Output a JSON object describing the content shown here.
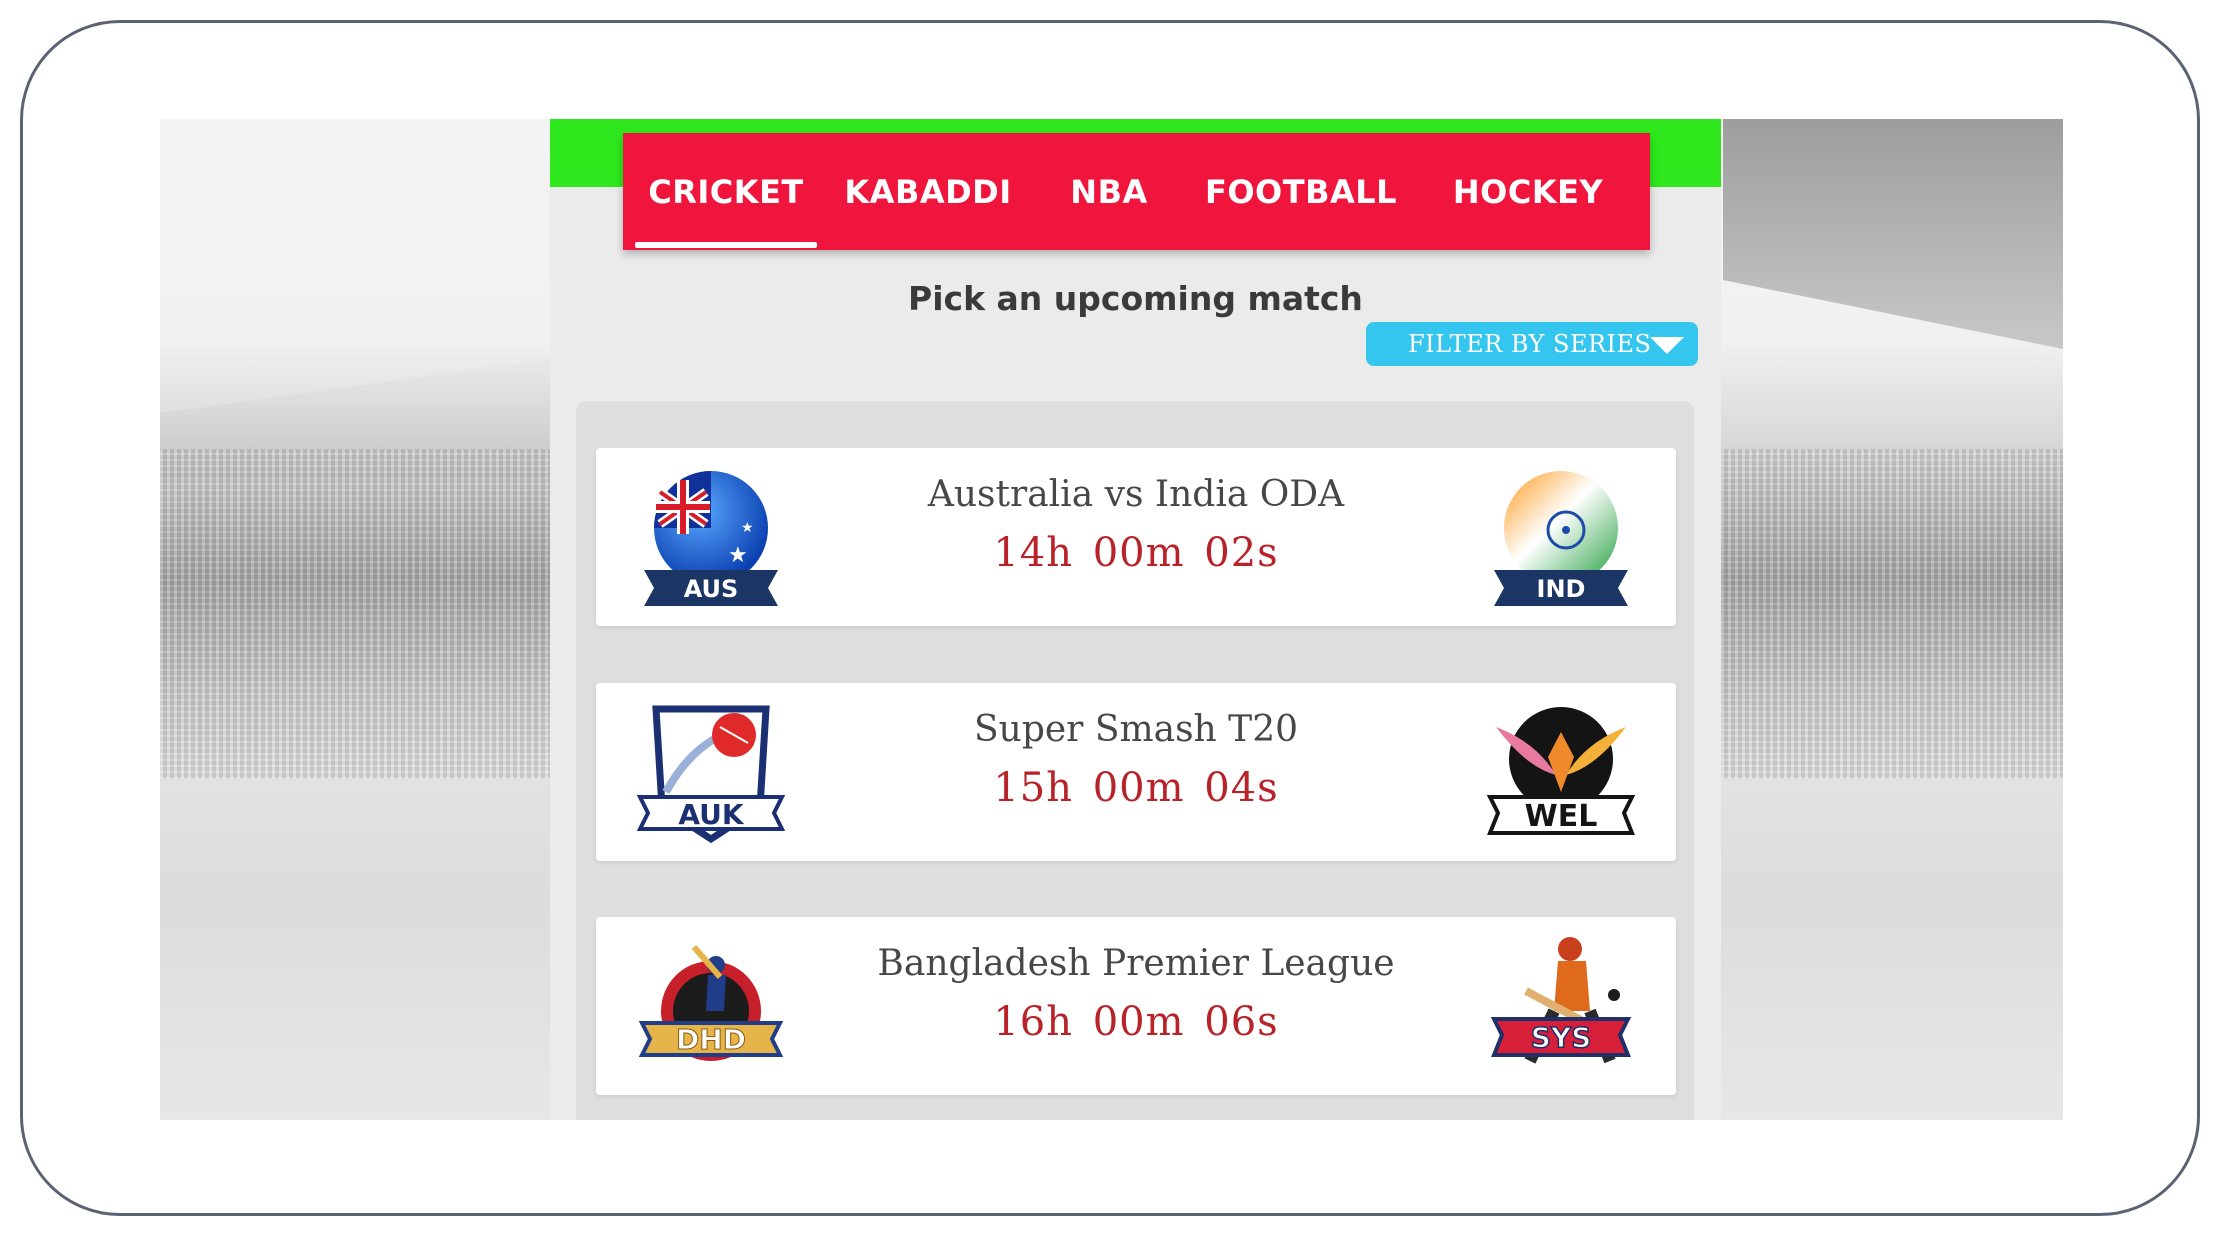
{
  "tabs": [
    {
      "label": "CRICKET",
      "active": true
    },
    {
      "label": "KABADDI",
      "active": false
    },
    {
      "label": "NBA",
      "active": false
    },
    {
      "label": "FOOTBALL",
      "active": false
    },
    {
      "label": "HOCKEY",
      "active": false
    }
  ],
  "header": {
    "subtitle": "Pick an upcoming match",
    "filter_label": "FILTER BY SERIES"
  },
  "matches": [
    {
      "name": "Australia vs India ODA",
      "countdown": "14h 00m 02s",
      "left_team": "AUS",
      "right_team": "IND",
      "left_icon": "australia-ball-logo-icon",
      "right_icon": "india-ball-logo-icon"
    },
    {
      "name": "Super Smash T20",
      "countdown": "15h 00m 04s",
      "left_team": "AUK",
      "right_team": "WEL",
      "left_icon": "auckland-shield-logo-icon",
      "right_icon": "wellington-firebird-logo-icon"
    },
    {
      "name": "Bangladesh Premier League",
      "countdown": "16h 00m 06s",
      "left_team": "DHD",
      "right_team": "SYS",
      "left_icon": "dhaka-batsman-logo-icon",
      "right_icon": "sylhet-batsman-logo-icon"
    }
  ],
  "colors": {
    "top_bar": "#2ee81d",
    "tab_bar": "#f0153d",
    "filter_button": "#34c6ee",
    "countdown": "#b8232a"
  }
}
